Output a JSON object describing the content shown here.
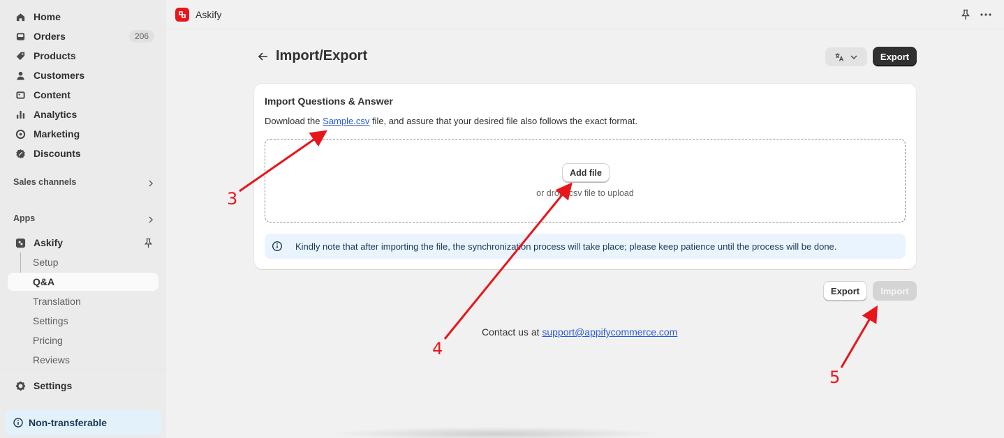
{
  "sidebar": {
    "nav": [
      {
        "label": "Home",
        "icon": "home-icon"
      },
      {
        "label": "Orders",
        "icon": "inbox-icon",
        "badge": "206"
      },
      {
        "label": "Products",
        "icon": "tag-icon"
      },
      {
        "label": "Customers",
        "icon": "person-icon"
      },
      {
        "label": "Content",
        "icon": "image-icon"
      },
      {
        "label": "Analytics",
        "icon": "bar-chart-icon"
      },
      {
        "label": "Marketing",
        "icon": "target-icon"
      },
      {
        "label": "Discounts",
        "icon": "discount-icon"
      }
    ],
    "sales_channels_label": "Sales channels",
    "apps_label": "Apps",
    "app_name": "Askify",
    "app_sub": [
      "Setup",
      "Q&A",
      "Translation",
      "Settings",
      "Pricing",
      "Reviews"
    ],
    "settings_label": "Settings",
    "non_transferable": "Non-transferable"
  },
  "topbar": {
    "app_title": "Askify"
  },
  "page": {
    "title": "Import/Export",
    "export_label": "Export",
    "card": {
      "title": "Import Questions & Answer",
      "desc_before": "Download the ",
      "desc_link": "Sample.csv",
      "desc_after": " file, and assure that your desired file also follows the exact format.",
      "add_file": "Add file",
      "drop_hint": "or drop .csv file to upload",
      "banner": "Kindly note that after importing the file, the synchronization process will take place; please keep patience until the process will be done."
    },
    "bottom_export": "Export",
    "bottom_import": "Import",
    "contact_prefix": "Contact us at ",
    "contact_email": "support@appifycommerce.com"
  },
  "annotations": {
    "labels": [
      "3",
      "4",
      "5"
    ],
    "color": "#e8161b"
  },
  "colors": {
    "brand": "#e8161b",
    "link": "#2a5bd7",
    "primary_button": "#303030"
  }
}
